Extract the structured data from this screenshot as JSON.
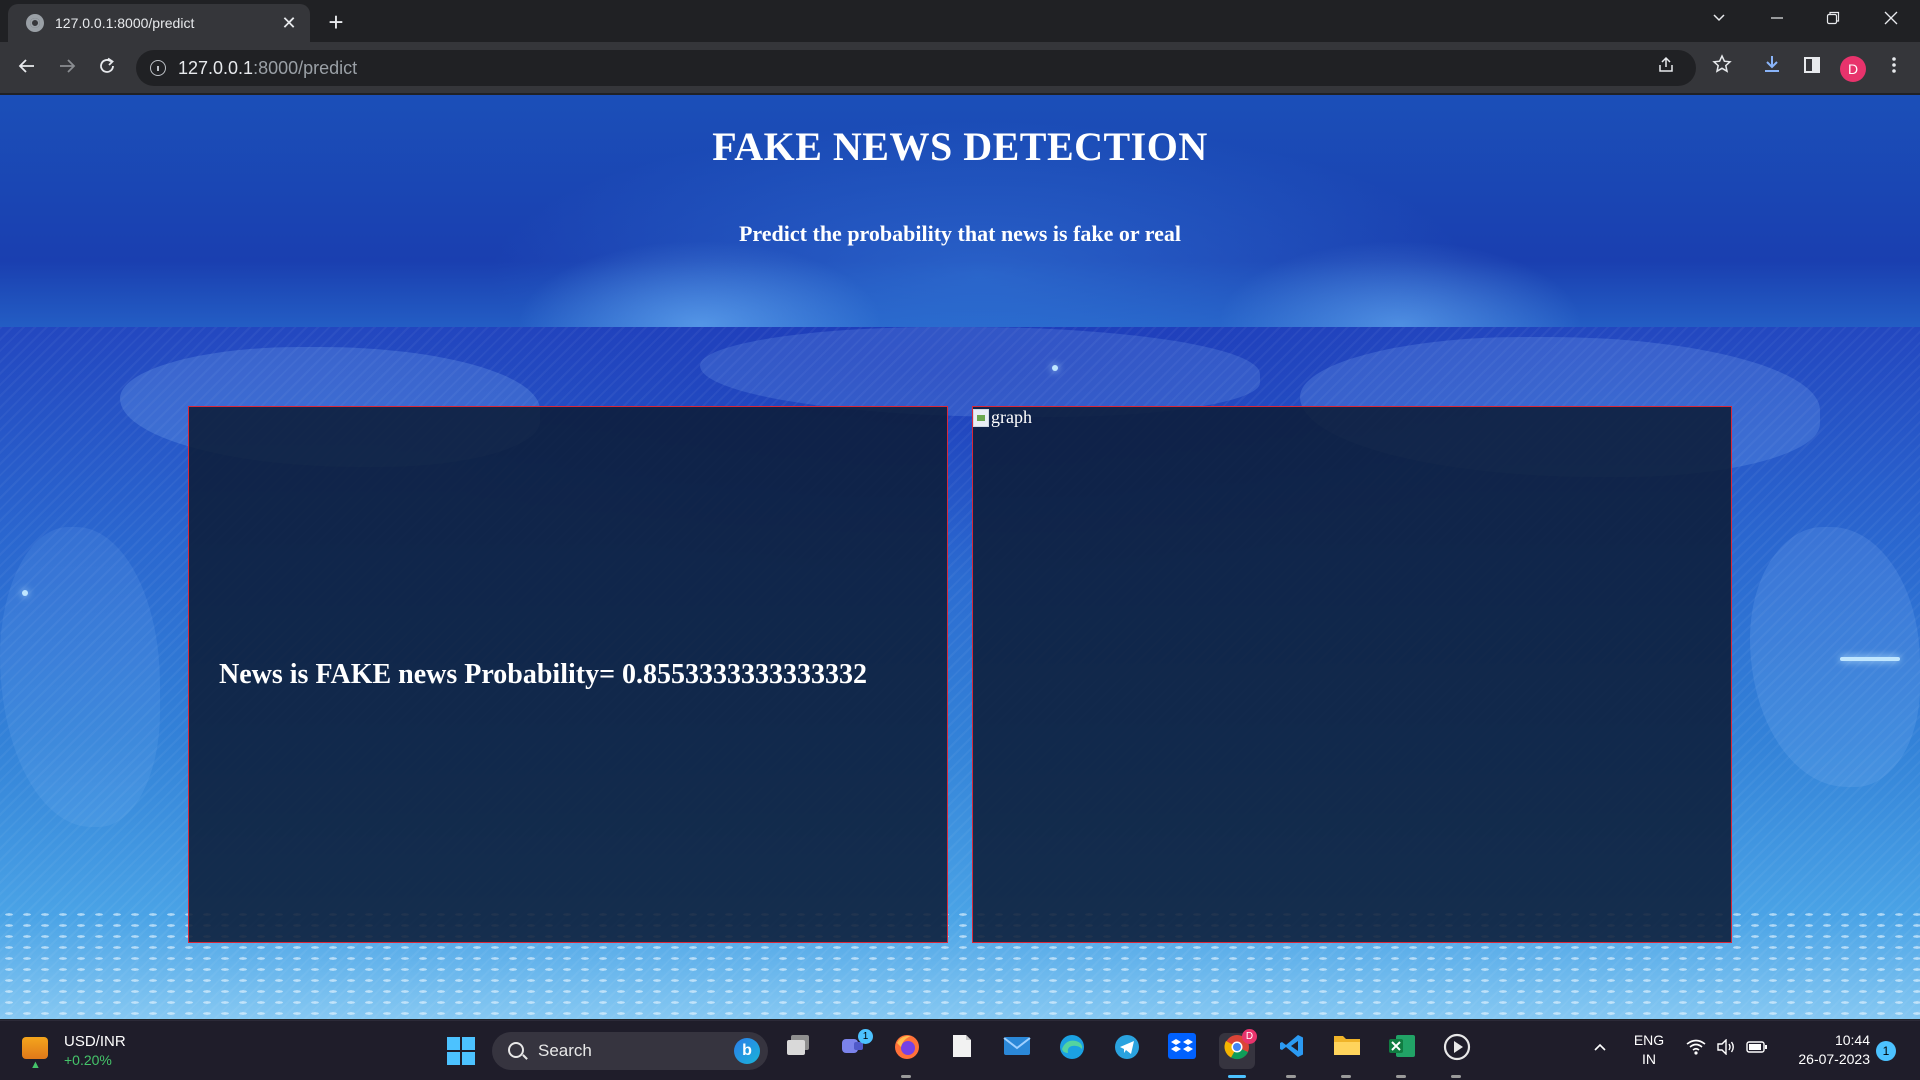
{
  "browser": {
    "tab_title": "127.0.0.1:8000/predict",
    "tab_close": "✕",
    "new_tab": "+",
    "url_host": "127.0.0.1",
    "url_path": ":8000/predict"
  },
  "page": {
    "title": "FAKE NEWS DETECTION",
    "subtitle": "Predict the probability that news is fake or real",
    "result": "News is FAKE news Probability= 0.8553333333333332",
    "graph_alt": "graph",
    "panel_border_color": "#d8283a"
  },
  "taskbar": {
    "widget_title": "USD/INR",
    "widget_change": "+0.20%",
    "search_placeholder": "Search",
    "teams_badge": "1",
    "chrome_badge": "D",
    "lang_line1": "ENG",
    "lang_line2": "IN",
    "time": "10:44",
    "date": "26-07-2023",
    "notifications": "1"
  },
  "profile_initial": "D"
}
